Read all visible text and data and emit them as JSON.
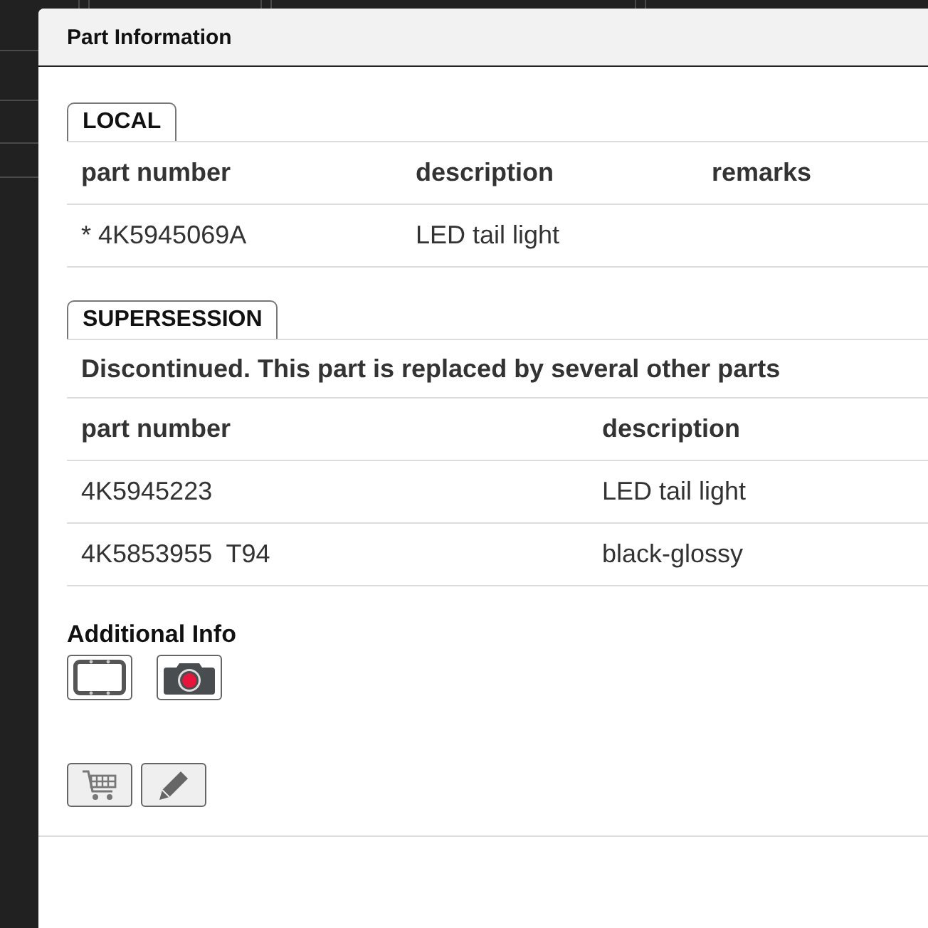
{
  "dialog": {
    "title": "Part Information"
  },
  "local": {
    "tab": "LOCAL",
    "columns": [
      "part number",
      "description",
      "remarks"
    ],
    "rows": [
      {
        "part_number": "* 4K5945069A",
        "description": "LED tail light"
      }
    ]
  },
  "supersession": {
    "tab": "SUPERSESSION",
    "message": "Discontinued. This part is replaced by several other parts",
    "columns": [
      "part number",
      "description"
    ],
    "rows": [
      {
        "part_number": "4K5945223",
        "description": "LED tail light"
      },
      {
        "part_number": "4K5853955  T94",
        "description": "black-glossy"
      }
    ]
  },
  "additional_info": {
    "heading": "Additional Info",
    "buttons": [
      {
        "kind": "frame"
      },
      {
        "kind": "camera"
      }
    ]
  },
  "actions": [
    {
      "kind": "cart"
    },
    {
      "kind": "edit"
    }
  ]
}
